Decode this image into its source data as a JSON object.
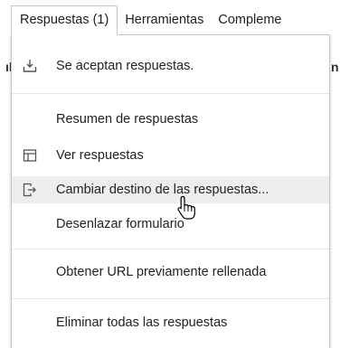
{
  "menubar": {
    "items": [
      {
        "label": "Respuestas (1)"
      },
      {
        "label": "Herramientas"
      },
      {
        "label": "Compleme"
      }
    ]
  },
  "dropdown": {
    "accepting": "Se aceptan respuestas.",
    "summary": "Resumen de respuestas",
    "view": "Ver respuestas",
    "change_destination": "Cambiar destino de las respuestas...",
    "unlink": "Desenlazar formulario",
    "prefilled": "Obtener URL previamente rellenada",
    "delete_all": "Eliminar todas las respuestas"
  },
  "icons": {
    "accepting": "inbox-download-icon",
    "view": "table-icon",
    "change_destination": "move-to-icon",
    "cursor": "hand-pointer-icon"
  }
}
